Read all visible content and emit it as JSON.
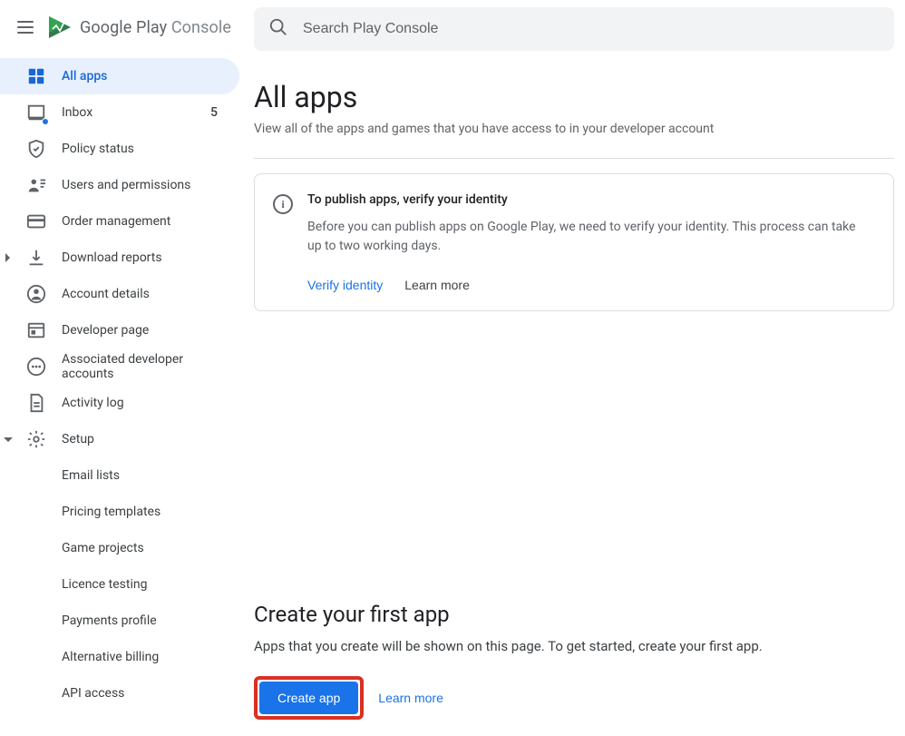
{
  "brand": {
    "name1": "Google Play ",
    "name2": "Console"
  },
  "search": {
    "placeholder": "Search Play Console"
  },
  "sidebar": {
    "items": [
      {
        "label": "All apps"
      },
      {
        "label": "Inbox",
        "badge": "5"
      },
      {
        "label": "Policy status"
      },
      {
        "label": "Users and permissions"
      },
      {
        "label": "Order management"
      },
      {
        "label": "Download reports"
      },
      {
        "label": "Account details"
      },
      {
        "label": "Developer page"
      },
      {
        "label": "Associated developer accounts"
      },
      {
        "label": "Activity log"
      },
      {
        "label": "Setup"
      }
    ],
    "setupChildren": [
      {
        "label": "Email lists"
      },
      {
        "label": "Pricing templates"
      },
      {
        "label": "Game projects"
      },
      {
        "label": "Licence testing"
      },
      {
        "label": "Payments profile"
      },
      {
        "label": "Alternative billing"
      },
      {
        "label": "API access"
      }
    ]
  },
  "page": {
    "title": "All apps",
    "subtitle": "View all of the apps and games that you have access to in your developer account"
  },
  "infoCard": {
    "title": "To publish apps, verify your identity",
    "body": "Before you can publish apps on Google Play, we need to verify your identity. This process can take up to two working days.",
    "primaryAction": "Verify identity",
    "secondaryAction": "Learn more"
  },
  "createSection": {
    "title": "Create your first app",
    "body": "Apps that you create will be shown on this page. To get started, create your first app.",
    "buttonLabel": "Create app",
    "learnMore": "Learn more"
  }
}
